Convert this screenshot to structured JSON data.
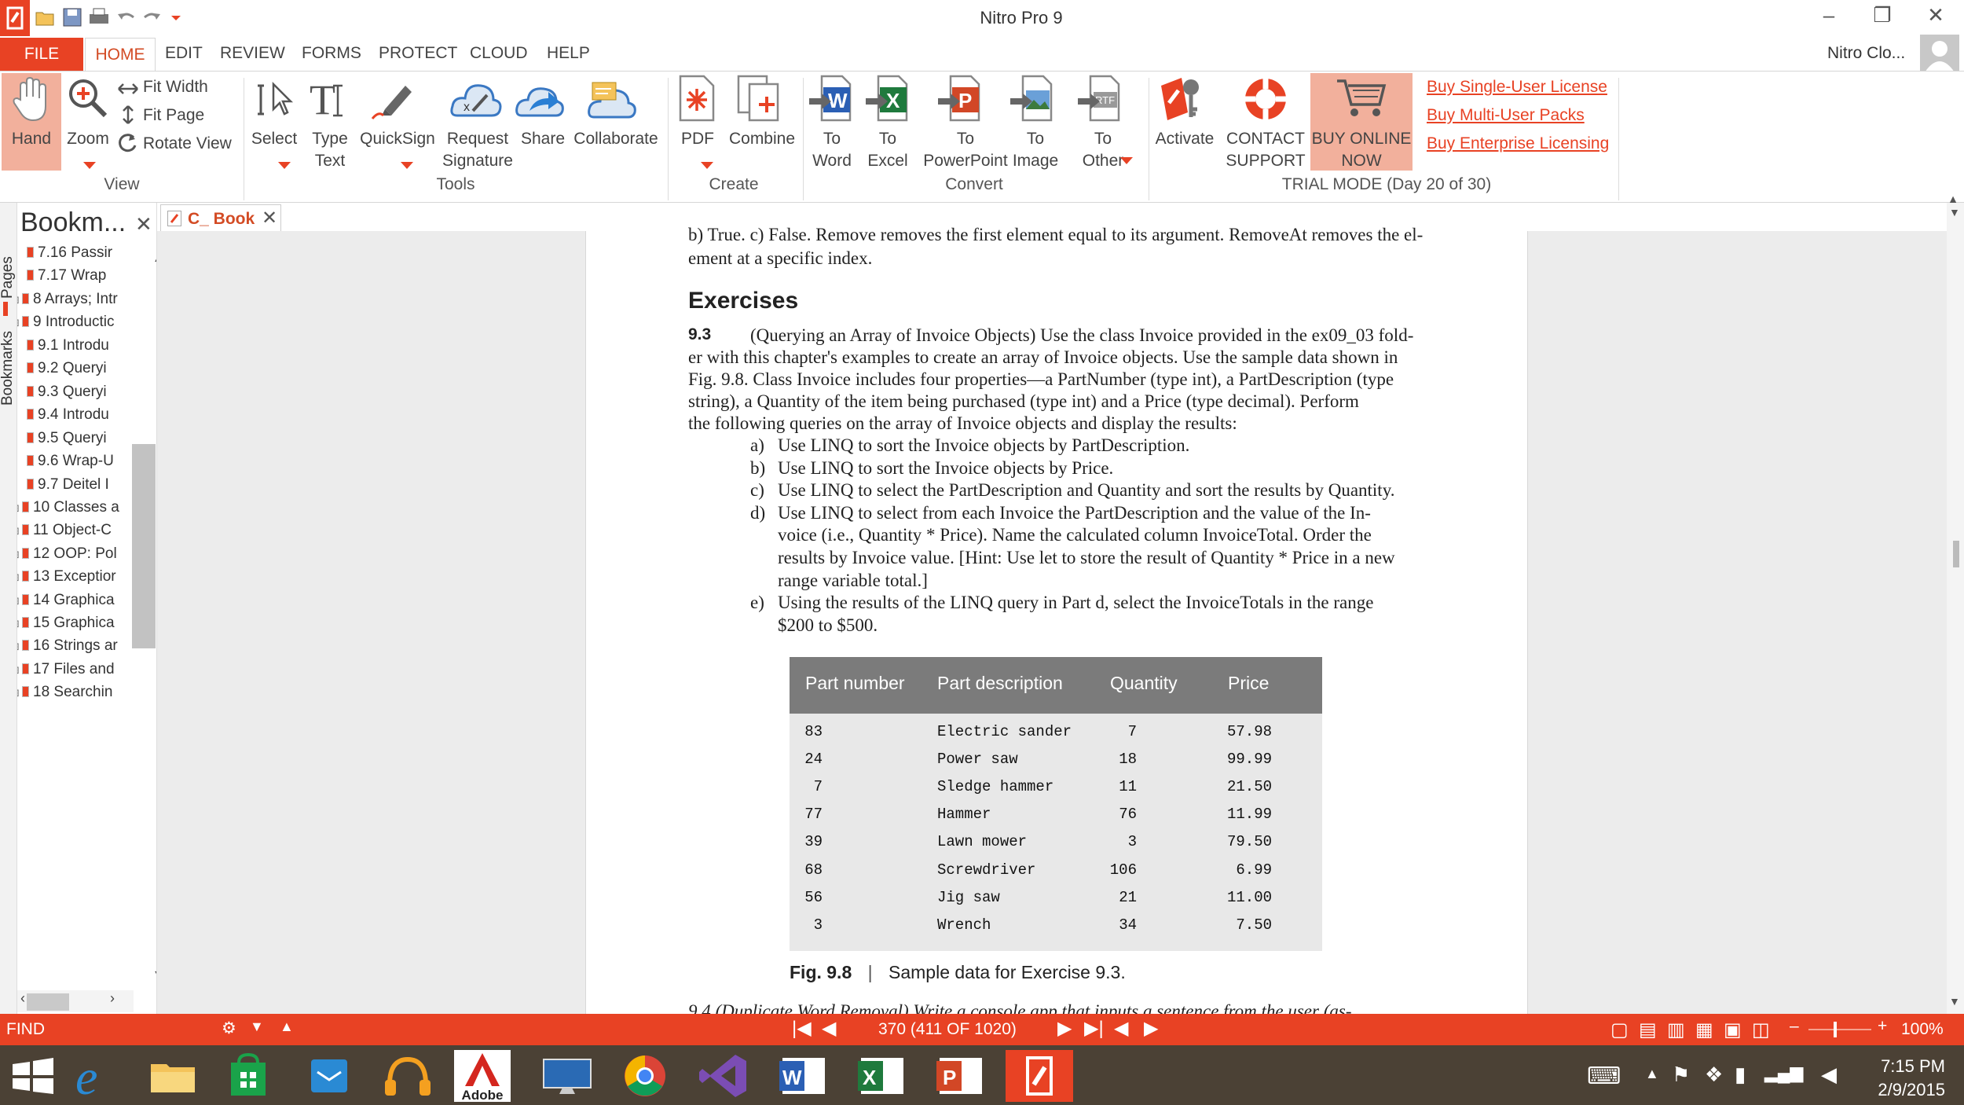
{
  "window": {
    "title": "Nitro Pro 9",
    "user": "Nitro Clo..."
  },
  "colors": {
    "accent": "#e84224",
    "page_bg": "#ececec",
    "taskbar": "#4b4135"
  },
  "ribbon_tabs": [
    "FILE",
    "HOME",
    "EDIT",
    "REVIEW",
    "FORMS",
    "PROTECT",
    "CLOUD",
    "HELP"
  ],
  "ribbon": {
    "view": {
      "hand": "Hand",
      "zoom": "Zoom",
      "fit_width": "Fit Width",
      "fit_page": "Fit Page",
      "rotate_view": "Rotate View",
      "label": "View"
    },
    "tools": {
      "select": "Select",
      "type_text_1": "Type",
      "type_text_2": "Text",
      "quicksign": "QuickSign",
      "request_1": "Request",
      "request_2": "Signature",
      "share": "Share",
      "collaborate": "Collaborate",
      "label": "Tools"
    },
    "create": {
      "pdf": "PDF",
      "combine": "Combine",
      "label": "Create"
    },
    "convert": {
      "to": "To",
      "word": "Word",
      "excel": "Excel",
      "powerpoint": "PowerPoint",
      "image": "Image",
      "other": "Other",
      "label": "Convert"
    },
    "trial": {
      "activate": "Activate",
      "contact_1": "CONTACT",
      "contact_2": "SUPPORT",
      "buy_1": "BUY ONLINE",
      "buy_2": "NOW",
      "link_single": "Buy Single-User License",
      "link_multi": "Buy Multi-User Packs",
      "link_enterprise": "Buy Enterprise Licensing",
      "label": "TRIAL MODE (Day 20 of 30)"
    }
  },
  "side_tabs": {
    "pages": "Pages",
    "bookmarks": "Bookmarks"
  },
  "bookmarks": {
    "title": "Bookm...",
    "items": [
      "7.16 Passir",
      "7.17 Wrap",
      "8 Arrays; Intr",
      "9 Introductic",
      "9.1 Introdu",
      "9.2 Queryi",
      "9.3 Queryi",
      "9.4 Introdu",
      "9.5 Queryi",
      "9.6 Wrap-U",
      "9.7 Deitel I",
      "10 Classes a",
      "11 Object-C",
      "12 OOP: Pol",
      "13 Exceptior",
      "14 Graphica",
      "15 Graphica",
      "16 Strings ar",
      "17 Files and",
      "18 Searchin"
    ]
  },
  "doc_tab": "C_ Book",
  "page": {
    "top_line_1": "b) True. c) False. Remove removes the first element equal to its argument. RemoveAt removes the el-",
    "top_line_2": "ement at a specific index.",
    "heading": "Exercises",
    "ex_num": "9.3",
    "para_1": "(Querying an Array of Invoice Objects) Use the class Invoice provided in the ex09_03 fold-",
    "para_2": "er with this chapter's examples to create an array of Invoice objects. Use the sample data shown in",
    "para_3": "Fig. 9.8. Class Invoice includes four properties—a PartNumber (type int), a PartDescription (type",
    "para_4": "string), a Quantity of the item being purchased (type int) and a Price (type decimal). Perform",
    "para_5": "the following queries on the array of Invoice objects and display the results:",
    "items": [
      {
        "letter": "a)",
        "lines": [
          "Use LINQ to sort the Invoice objects by PartDescription."
        ]
      },
      {
        "letter": "b)",
        "lines": [
          "Use LINQ to sort the Invoice objects by Price."
        ]
      },
      {
        "letter": "c)",
        "lines": [
          "Use LINQ to select the PartDescription and Quantity and sort the results by Quantity."
        ]
      },
      {
        "letter": "d)",
        "lines": [
          "Use LINQ to select from each Invoice the PartDescription and the value of the In-",
          "voice (i.e., Quantity * Price). Name the calculated column InvoiceTotal. Order the",
          "results by Invoice value. [Hint: Use let to store the result of Quantity * Price in a new",
          "range variable total.]"
        ]
      },
      {
        "letter": "e)",
        "lines": [
          "Using the results of the LINQ query in Part d, select the InvoiceTotals in the range",
          "$200 to $500."
        ]
      }
    ],
    "table": {
      "headers": [
        "Part number",
        "Part description",
        "Quantity",
        "Price"
      ],
      "rows": [
        [
          "83",
          "Electric sander",
          "7",
          "57.98"
        ],
        [
          "24",
          "Power saw",
          "18",
          "99.99"
        ],
        [
          "7",
          "Sledge hammer",
          "11",
          "21.50"
        ],
        [
          "77",
          "Hammer",
          "76",
          "11.99"
        ],
        [
          "39",
          "Lawn mower",
          "3",
          "79.50"
        ],
        [
          "68",
          "Screwdriver",
          "106",
          "6.99"
        ],
        [
          "56",
          "Jig saw",
          "21",
          "11.00"
        ],
        [
          "3",
          "Wrench",
          "34",
          "7.50"
        ]
      ]
    },
    "fig_label": "Fig. 9.8",
    "fig_caption": "Sample data for Exercise 9.3.",
    "cut_line": "9.4      (Duplicate Word Removal) Write a console app that inputs a sentence from the user (as-"
  },
  "status": {
    "find": "FIND",
    "page_display": "370 (411 OF 1020)",
    "zoom": "100%"
  },
  "taskbar": {
    "clock_time": "7:15 PM",
    "clock_date": "2/9/2015",
    "adobe_label": "Adobe"
  }
}
